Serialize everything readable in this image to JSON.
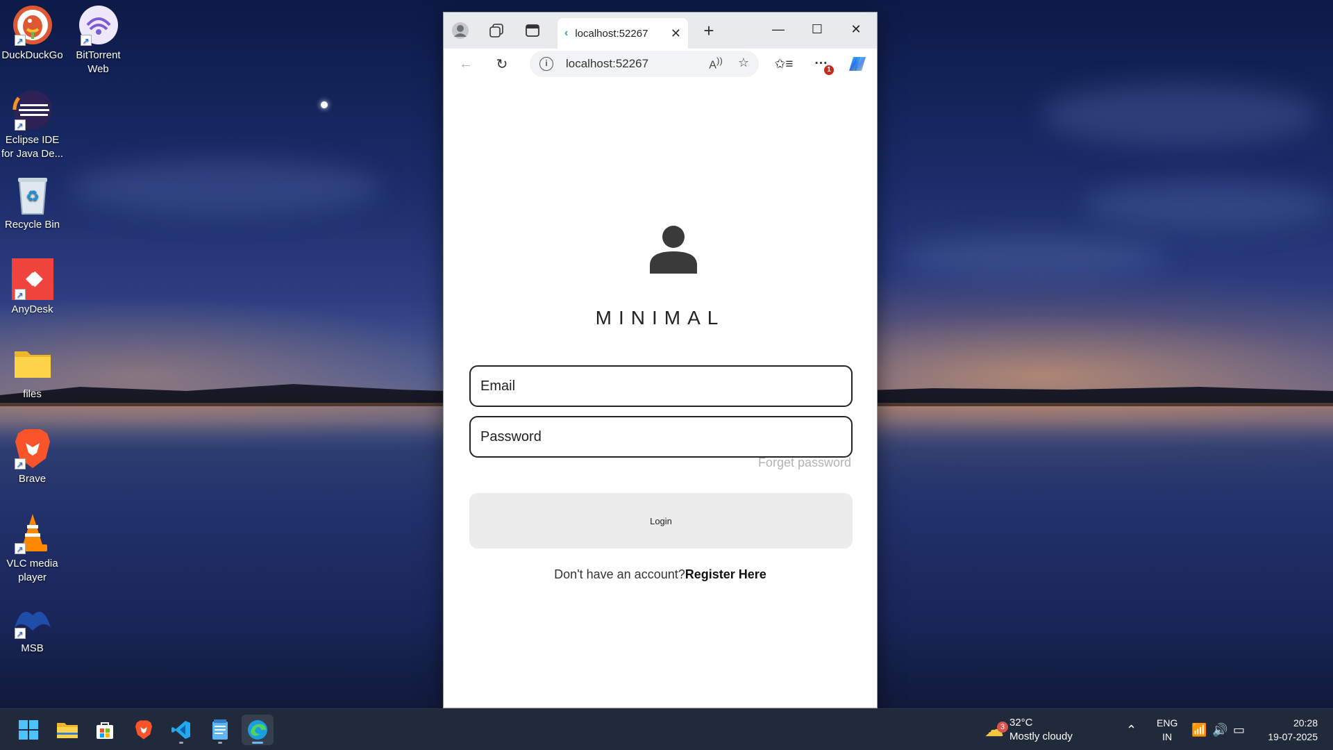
{
  "desktop": {
    "icons": [
      {
        "label": "DuckDuckGo",
        "icon": "duckduckgo-icon"
      },
      {
        "label": "BitTorrent Web",
        "icon": "bittorrent-icon"
      },
      {
        "label": "Eclipse IDE for Java De...",
        "icon": "eclipse-icon"
      },
      {
        "label": "Recycle Bin",
        "icon": "recycle-bin-icon"
      },
      {
        "label": "AnyDesk",
        "icon": "anydesk-icon"
      },
      {
        "label": "files",
        "icon": "folder-icon"
      },
      {
        "label": "Brave",
        "icon": "brave-icon"
      },
      {
        "label": "VLC media player",
        "icon": "vlc-icon"
      },
      {
        "label": "MSB",
        "icon": "msb-icon"
      }
    ]
  },
  "browser": {
    "tab_title": "localhost:52267",
    "url": "localhost:52267",
    "new_tab": "+",
    "notification_count": "1"
  },
  "app": {
    "brand": "MINIMAL",
    "email_placeholder": "Email",
    "password_placeholder": "Password",
    "forget_password": "Forget password",
    "login_label": "Login",
    "no_account_text": "Don't have an account?",
    "register_link": "Register Here"
  },
  "taskbar": {
    "weather_badge": "3",
    "temperature": "32°C",
    "weather_desc": "Mostly cloudy",
    "lang": "ENG",
    "region": "IN",
    "time": "20:28",
    "date": "19-07-2025"
  },
  "colors": {
    "accent": "#6cb8ff",
    "flutter_blue": "#3b8be0",
    "login_bg": "#ececec"
  }
}
